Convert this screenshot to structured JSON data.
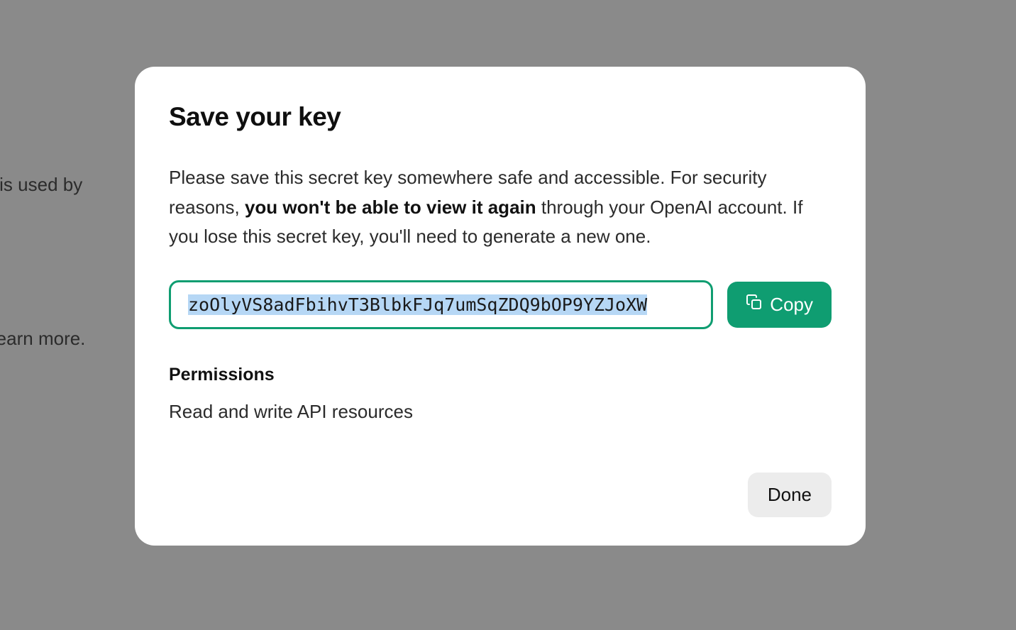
{
  "background": {
    "text_fragment_1": "tion is used by",
    "text_fragment_2": "to learn more."
  },
  "modal": {
    "title": "Save your key",
    "description_before": "Please save this secret key somewhere safe and accessible. For security reasons, ",
    "description_bold": "you won't be able to view it again",
    "description_after": " through your OpenAI account. If you lose this secret key, you'll need to generate a new one.",
    "key_value": "zoOlyVS8adFbihvT3BlbkFJq7umSqZDQ9bOP9YZJoXW",
    "copy_label": "Copy",
    "permissions_heading": "Permissions",
    "permissions_text": "Read and write API resources",
    "done_label": "Done"
  }
}
